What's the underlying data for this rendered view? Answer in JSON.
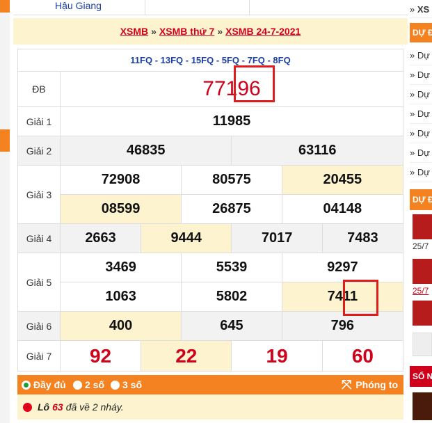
{
  "top": {
    "province": "Hậu Giang"
  },
  "breadcrumb": {
    "l1": "XSMB",
    "l2": "XSMB thứ 7",
    "l3": "XSMB 24-7-2021",
    "sep": "»"
  },
  "codes": "11FQ - 13FQ - 15FQ - 5FQ - 7FQ - 8FQ",
  "prizes": {
    "db": {
      "label": "ĐB",
      "value": "77196"
    },
    "g1": {
      "label": "Giải 1",
      "values": [
        "11985"
      ]
    },
    "g2": {
      "label": "Giải 2",
      "values": [
        "46835",
        "63116"
      ]
    },
    "g3": {
      "label": "Giải 3",
      "values": [
        "72908",
        "80575",
        "20455",
        "08599",
        "26875",
        "04148"
      ]
    },
    "g4": {
      "label": "Giải 4",
      "values": [
        "2663",
        "9444",
        "7017",
        "7483"
      ]
    },
    "g5": {
      "label": "Giải 5",
      "values": [
        "3469",
        "5539",
        "9297",
        "1063",
        "5802",
        "7411"
      ]
    },
    "g6": {
      "label": "Giải 6",
      "values": [
        "400",
        "645",
        "796"
      ]
    },
    "g7": {
      "label": "Giải 7",
      "values": [
        "92",
        "22",
        "19",
        "60"
      ]
    }
  },
  "options": {
    "full": "Đầy đủ",
    "two": "2 số",
    "three": "3 số",
    "zoom": "Phóng to"
  },
  "lo": {
    "prefix": "Lô",
    "number": "63",
    "suffix": "đã về 2 nháy."
  },
  "sidebar": {
    "top_item": "XS",
    "head1": "DỰ Đ",
    "items": [
      "Dự",
      "Dự",
      "Dự",
      "Dự",
      "Dự",
      "Dự",
      "Dự"
    ],
    "head2": "DỰ Đ",
    "dates": [
      "25/7",
      "25/7"
    ],
    "head3": "SỐ N"
  },
  "colors": {
    "accent": "#f58220",
    "highlight": "#fdf3cf",
    "red": "#d0021b",
    "blue": "#1a3fa0"
  }
}
